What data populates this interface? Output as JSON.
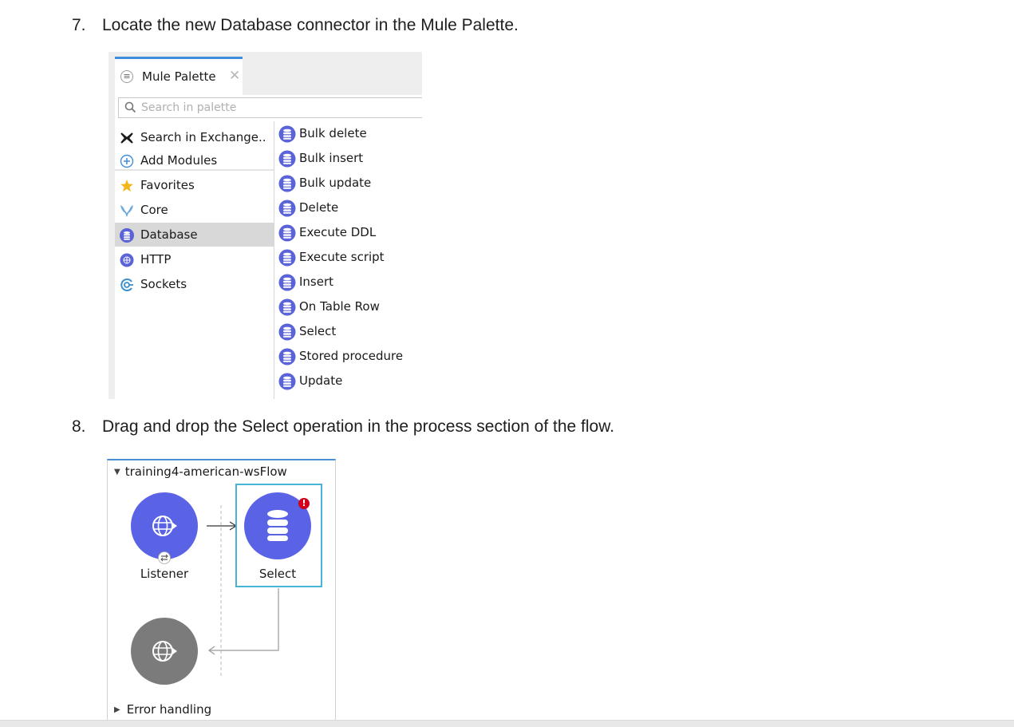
{
  "steps": [
    {
      "number": "7.",
      "text": "Locate the new Database connector in the Mule Palette."
    },
    {
      "number": "8.",
      "text": "Drag and drop the Select operation in the process section of the flow."
    }
  ],
  "palette": {
    "tab_label": "Mule Palette",
    "close_glyph": "✕",
    "search_placeholder": "Search in palette",
    "left_items": [
      {
        "label": "Search in Exchange..",
        "icon": "exchange-icon"
      },
      {
        "label": "Add Modules",
        "icon": "add-circle-icon"
      },
      {
        "label": "Favorites",
        "icon": "star-icon"
      },
      {
        "label": "Core",
        "icon": "mule-core-icon"
      },
      {
        "label": "Database",
        "icon": "database-icon",
        "selected": true
      },
      {
        "label": "HTTP",
        "icon": "http-icon"
      },
      {
        "label": "Sockets",
        "icon": "sockets-icon"
      }
    ],
    "operations": [
      "Bulk delete",
      "Bulk insert",
      "Bulk update",
      "Delete",
      "Execute DDL",
      "Execute script",
      "Insert",
      "On Table Row",
      "Select",
      "Stored procedure",
      "Update"
    ],
    "colors": {
      "accent": "#3f8edc",
      "db_icon": "#5a63d8",
      "star": "#f3b51a",
      "selected_row": "#d8d8d8"
    }
  },
  "flow": {
    "title": "training4-american-wsFlow",
    "nodes": [
      {
        "label": "Listener",
        "icon": "globe-icon",
        "color": "#5a63e6"
      },
      {
        "label": "Select",
        "icon": "database-icon",
        "color": "#5a63e6"
      }
    ],
    "error_badge": "!",
    "error_handling_label": "Error handling",
    "colors": {
      "selection_border": "#47b4d6",
      "error": "#d0021b",
      "response_node": "#7b7b7b"
    }
  }
}
